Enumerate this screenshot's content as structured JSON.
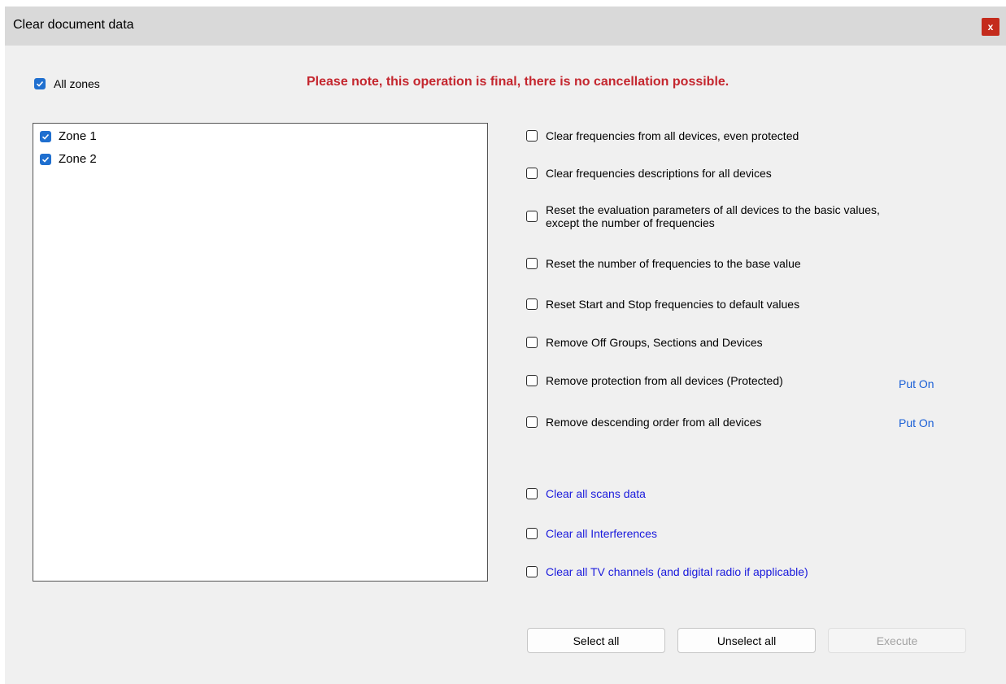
{
  "window": {
    "title": "Clear document data",
    "close_label": "x"
  },
  "all_zones": {
    "label": "All zones",
    "checked": true
  },
  "warning": "Please note, this operation is final, there is no cancellation possible.",
  "zones": [
    {
      "label": "Zone 1",
      "checked": true
    },
    {
      "label": "Zone 2",
      "checked": true
    }
  ],
  "options": [
    {
      "label": "Clear frequencies from all devices, even protected",
      "checked": false
    },
    {
      "label": "Clear frequencies descriptions for all devices",
      "checked": false
    },
    {
      "label_line1": "Reset the evaluation parameters of all devices to the basic values,",
      "label_line2": "except the number of frequencies",
      "checked": false
    },
    {
      "label": "Reset the number of frequencies to the base value",
      "checked": false
    },
    {
      "label": "Reset Start and Stop frequencies to default values",
      "checked": false
    },
    {
      "label": "Remove Off Groups, Sections and Devices",
      "checked": false
    },
    {
      "label": "Remove protection from all devices (Protected)",
      "checked": false,
      "action": "Put On"
    },
    {
      "label": "Remove descending order from all devices",
      "checked": false,
      "action": "Put On"
    }
  ],
  "extra_options": [
    {
      "label": "Clear all scans data",
      "checked": false
    },
    {
      "label": "Clear all Interferences",
      "checked": false
    },
    {
      "label": "Clear all TV channels (and digital radio if applicable)",
      "checked": false
    }
  ],
  "buttons": {
    "select_all": "Select all",
    "unselect_all": "Unselect all",
    "execute": "Execute",
    "execute_enabled": false
  },
  "colors": {
    "accent": "#1f6fcf",
    "warning": "#c4262e",
    "link": "#1a5fd6",
    "extra_option_text": "#1a1adc",
    "close_button": "#c42b1c"
  }
}
